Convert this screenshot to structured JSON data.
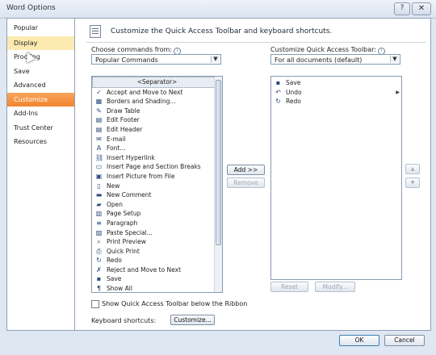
{
  "window": {
    "title": "Word Options",
    "close": "✕",
    "help": "?"
  },
  "nav": {
    "items": [
      {
        "label": "Popular"
      },
      {
        "label": "Display"
      },
      {
        "label": "Proofing"
      },
      {
        "label": "Save"
      },
      {
        "label": "Advanced"
      },
      {
        "label": "Customize"
      },
      {
        "label": "Add-Ins"
      },
      {
        "label": "Trust Center"
      },
      {
        "label": "Resources"
      }
    ]
  },
  "header": {
    "text": "Customize the Quick Access Toolbar and keyboard shortcuts."
  },
  "left": {
    "label": "Choose commands from:",
    "combo": "Popular Commands",
    "commands": [
      {
        "label": "<Separator>",
        "icon": "separator-icon",
        "glyph": ""
      },
      {
        "label": "Accept and Move to Next",
        "icon": "accept-icon",
        "glyph": "✓"
      },
      {
        "label": "Borders and Shading...",
        "icon": "borders-icon",
        "glyph": "▦"
      },
      {
        "label": "Draw Table",
        "icon": "draw-table-icon",
        "glyph": "✎"
      },
      {
        "label": "Edit Footer",
        "icon": "footer-icon",
        "glyph": "▤"
      },
      {
        "label": "Edit Header",
        "icon": "header-icon",
        "glyph": "▤"
      },
      {
        "label": "E-mail",
        "icon": "email-icon",
        "glyph": "✉"
      },
      {
        "label": "Font...",
        "icon": "font-icon",
        "glyph": "A"
      },
      {
        "label": "Insert Hyperlink",
        "icon": "hyperlink-icon",
        "glyph": "⛓"
      },
      {
        "label": "Insert Page and Section Breaks",
        "icon": "page-break-icon",
        "glyph": "▭",
        "submenu": true
      },
      {
        "label": "Insert Picture from File",
        "icon": "picture-icon",
        "glyph": "▣"
      },
      {
        "label": "New",
        "icon": "new-doc-icon",
        "glyph": "▯"
      },
      {
        "label": "New Comment",
        "icon": "comment-icon",
        "glyph": "▬"
      },
      {
        "label": "Open",
        "icon": "open-folder-icon",
        "glyph": "▰"
      },
      {
        "label": "Page Setup",
        "icon": "page-setup-icon",
        "glyph": "▥"
      },
      {
        "label": "Paragraph",
        "icon": "paragraph-icon",
        "glyph": "≡"
      },
      {
        "label": "Paste Special...",
        "icon": "paste-icon",
        "glyph": "▨"
      },
      {
        "label": "Print Preview",
        "icon": "print-preview-icon",
        "glyph": "⌕"
      },
      {
        "label": "Quick Print",
        "icon": "print-icon",
        "glyph": "⎙"
      },
      {
        "label": "Redo",
        "icon": "redo-icon",
        "glyph": "↻"
      },
      {
        "label": "Reject and Move to Next",
        "icon": "reject-icon",
        "glyph": "✗"
      },
      {
        "label": "Save",
        "icon": "save-icon",
        "glyph": "▪"
      },
      {
        "label": "Show All",
        "icon": "pilcrow-icon",
        "glyph": "¶"
      }
    ]
  },
  "right": {
    "label": "Customize Quick Access Toolbar:",
    "combo": "For all documents (default)",
    "items": [
      {
        "label": "Save",
        "icon": "save-icon",
        "glyph": "▪"
      },
      {
        "label": "Undo",
        "icon": "undo-icon",
        "glyph": "↶",
        "submenu": true
      },
      {
        "label": "Redo",
        "icon": "redo-icon",
        "glyph": "↻"
      }
    ]
  },
  "buttons": {
    "add": "Add >>",
    "remove": "Remove",
    "reset": "Reset",
    "modify": "Modify...",
    "up": "▲",
    "down": "▼",
    "customize": "Customize...",
    "ok": "OK",
    "cancel": "Cancel"
  },
  "options": {
    "show_below": "Show Quick Access Toolbar below the Ribbon",
    "show_below_checked": false,
    "keyboard_label": "Keyboard shortcuts:"
  }
}
